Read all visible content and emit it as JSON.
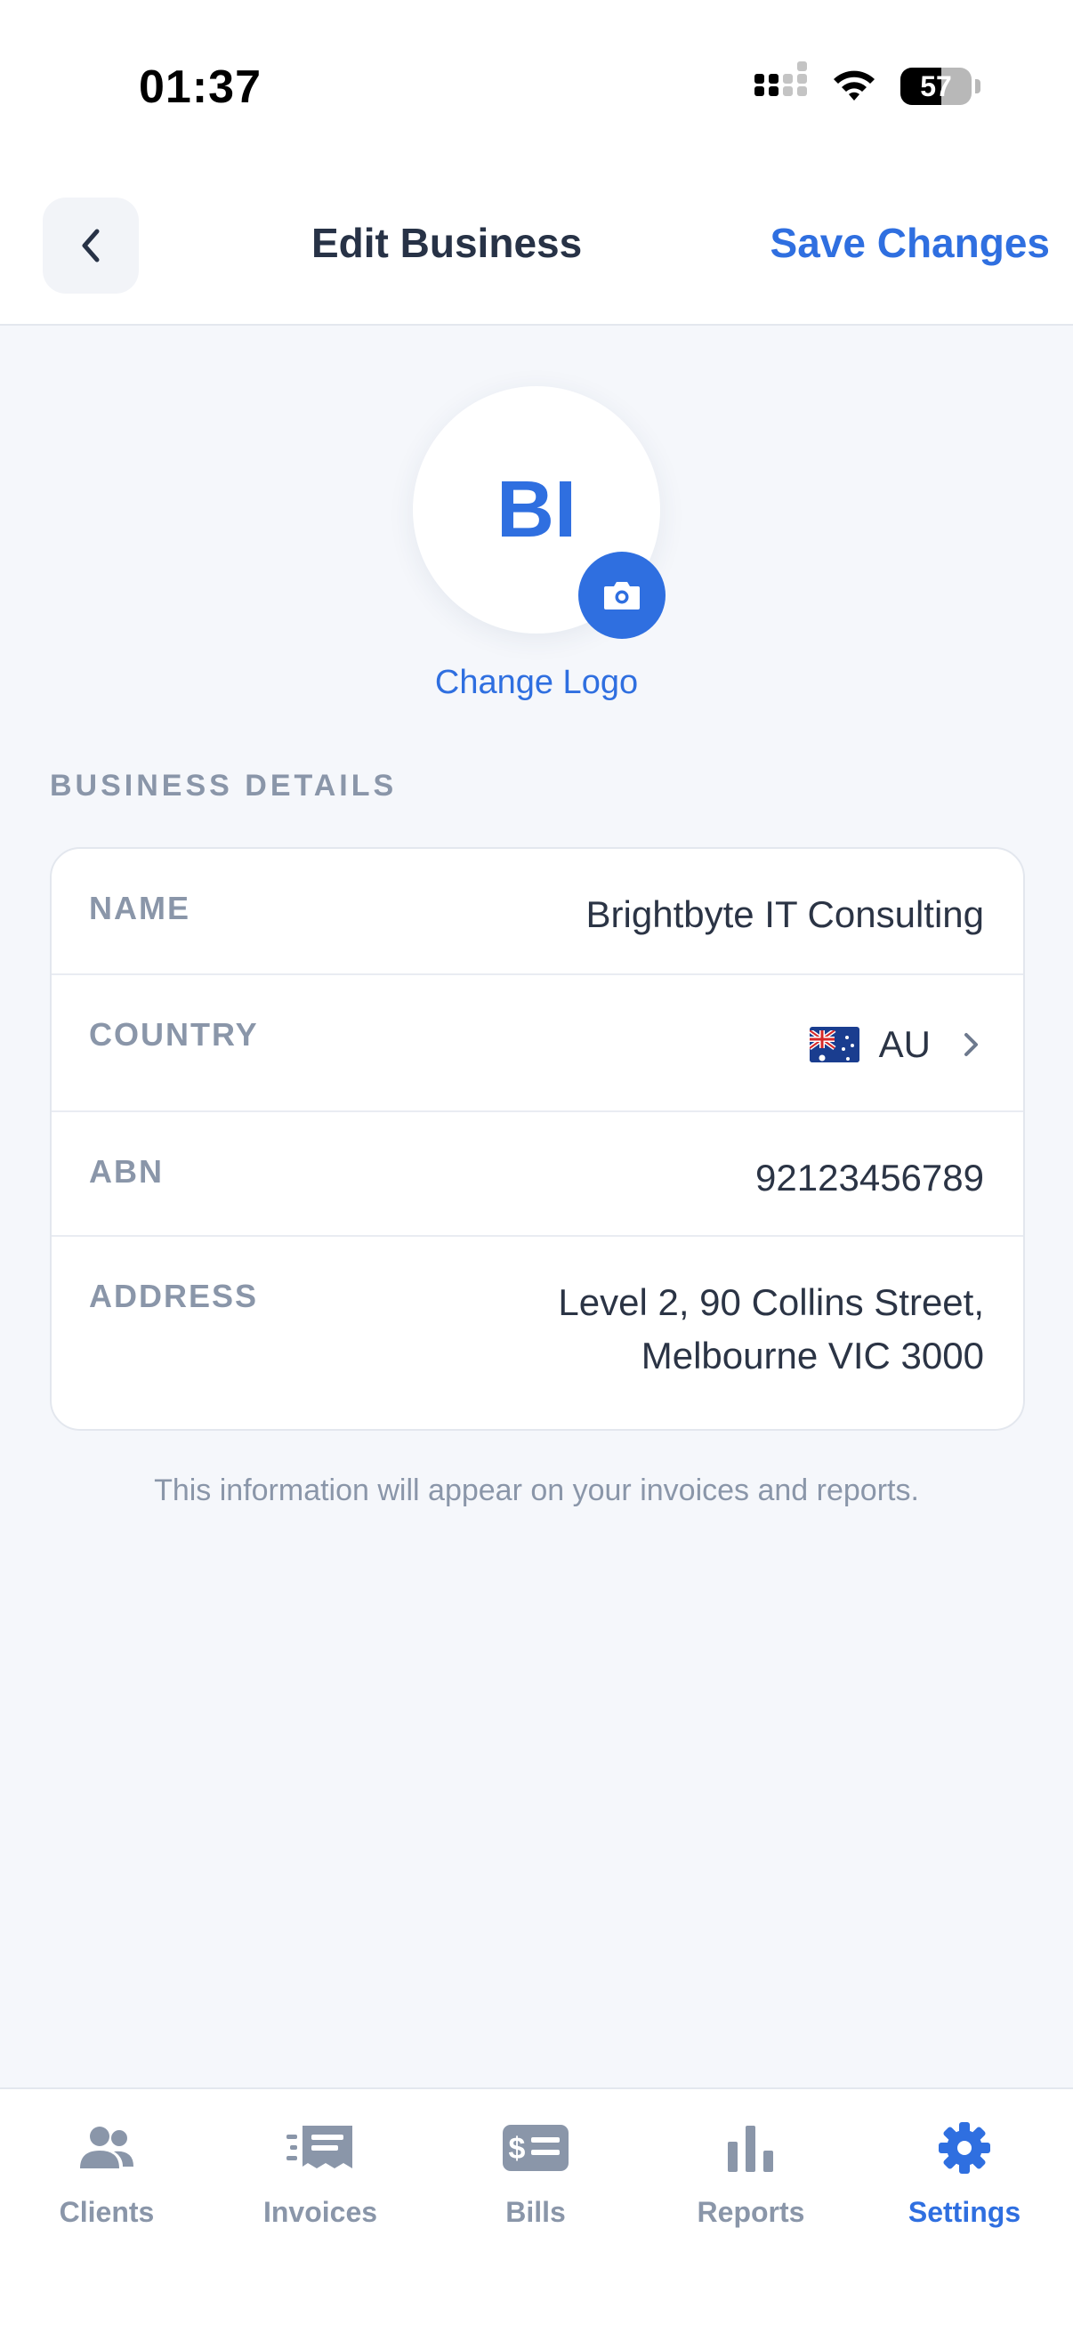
{
  "status_bar": {
    "time": "01:37",
    "battery": "57"
  },
  "header": {
    "title": "Edit Business",
    "save_label": "Save Changes"
  },
  "logo": {
    "initials": "BI",
    "change_label": "Change Logo"
  },
  "section": {
    "label": "BUSINESS DETAILS"
  },
  "details": {
    "name": {
      "label": "NAME",
      "value": "Brightbyte IT Consulting"
    },
    "country": {
      "label": "COUNTRY",
      "value": "AU"
    },
    "abn": {
      "label": "ABN",
      "value": "92123456789"
    },
    "address": {
      "label": "ADDRESS",
      "line1": "Level 2, 90 Collins Street,",
      "line2": "Melbourne VIC 3000"
    }
  },
  "note": "This information will appear on your invoices and reports.",
  "tabs": [
    {
      "label": "Clients",
      "icon": "users-icon"
    },
    {
      "label": "Invoices",
      "icon": "invoice-icon"
    },
    {
      "label": "Bills",
      "icon": "bill-icon"
    },
    {
      "label": "Reports",
      "icon": "bar-chart-icon"
    },
    {
      "label": "Settings",
      "icon": "gear-icon",
      "active": true
    }
  ],
  "colors": {
    "accent": "#2f6fe0",
    "muted": "#8a96a9",
    "text": "#2b3445",
    "background": "#f5f7fb"
  }
}
